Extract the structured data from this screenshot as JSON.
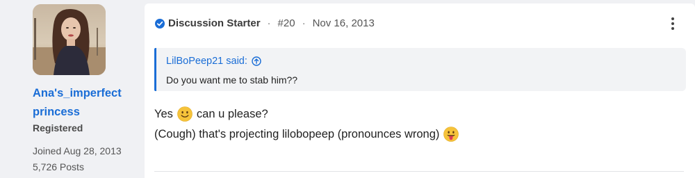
{
  "user": {
    "username": "Ana's_imperfect princess",
    "title": "Registered",
    "joined": "Joined Aug 28, 2013",
    "posts": "5,726 Posts"
  },
  "post": {
    "starter_label": "Discussion Starter",
    "number": "#20",
    "date": "Nov 16, 2013",
    "quote": {
      "author": "LilBoPeep21 said:",
      "text": "Do you want me to stab him??"
    },
    "body": {
      "line1_before": "Yes",
      "line1_after": "can u please?",
      "line2_text": "(Cough) that's projecting lilobopeep (pronounces wrong)"
    },
    "separator": "·"
  },
  "colors": {
    "accent": "#1a6dd6",
    "emoji_yellow": "#f6c33a",
    "tongue": "#e8455b"
  }
}
